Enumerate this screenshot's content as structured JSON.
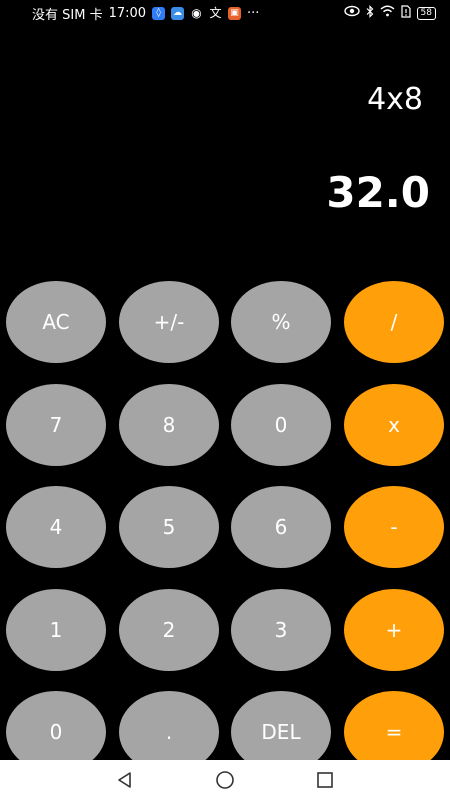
{
  "status_bar": {
    "carrier": "没有 SIM 卡",
    "time": "17:00",
    "more": "···",
    "battery": "58"
  },
  "display": {
    "expression": "4x8",
    "result": "32.0"
  },
  "keys": {
    "ac": "AC",
    "plus_minus": "+/-",
    "percent": "%",
    "divide": "/",
    "seven": "7",
    "eight": "8",
    "zero_top": "0",
    "multiply": "x",
    "four": "4",
    "five": "5",
    "six": "6",
    "minus": "-",
    "one": "1",
    "two": "2",
    "three": "3",
    "plus": "+",
    "zero": "0",
    "dot": ".",
    "del": "DEL",
    "equals": "="
  },
  "colors": {
    "background": "#000000",
    "grey_key": "#a5a5a5",
    "orange_key": "#ff9f0a",
    "nav_bar": "#ffffff"
  }
}
